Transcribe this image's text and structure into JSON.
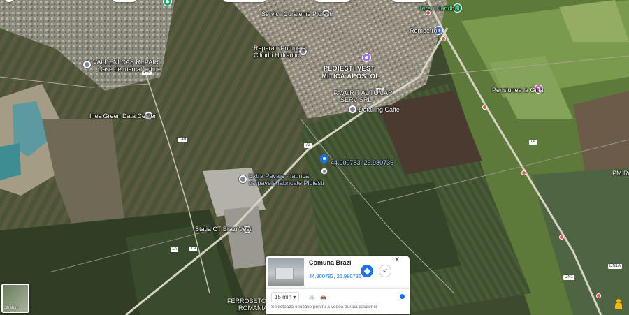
{
  "map": {
    "places": [
      {
        "id": "servicii",
        "label": "Servicii Curatenie Ploiesti"
      },
      {
        "id": "teren",
        "label": "Teren Handbal"
      },
      {
        "id": "rompetrol",
        "label": "Rompetrol"
      },
      {
        "id": "pompe1",
        "label": "Reparatii Pompe si"
      },
      {
        "id": "pompe2",
        "label": "Cilindri Hidraulici"
      },
      {
        "id": "valdeni1",
        "label": "VALDENI CAS REPAIR"
      },
      {
        "id": "valdeni2",
        "label": "Case de marcat ieftine"
      },
      {
        "id": "ploiesti_vest",
        "label": "PLOIESTI VEST"
      },
      {
        "id": "mitica",
        "label": "MITICA APOSTOL"
      },
      {
        "id": "favorit1",
        "label": "FAVORIT AUTOMAR"
      },
      {
        "id": "favorit2",
        "label": "SERV SRL"
      },
      {
        "id": "detailing",
        "label": "Detailing Caffe"
      },
      {
        "id": "pensiunea",
        "label": "Pensiunea la Gina"
      },
      {
        "id": "ines",
        "label": "Ines Green Data Center"
      },
      {
        "id": "coord_label",
        "label": "44.900783, 25.980736"
      },
      {
        "id": "fabrica1",
        "label": "Extra Pavaje - fabrica"
      },
      {
        "id": "fabrica2",
        "label": "de pavele fabricate Ploiesti"
      },
      {
        "id": "statia",
        "label": "Stația CT Brazi Vest"
      },
      {
        "id": "ferrobet1",
        "label": "FERROBETON"
      },
      {
        "id": "ferrobet2",
        "label": "ROMANIA"
      },
      {
        "id": "pm",
        "label": "PM Ran"
      }
    ],
    "road_badges": [
      "140",
      "140",
      "72",
      "72",
      "1A",
      "1A",
      "1A",
      "DN1",
      "DN1A"
    ]
  },
  "place_card": {
    "title": "Comuna Brazi",
    "coords": "44.900783, 25.980736",
    "close": "✕",
    "share": "<"
  },
  "travel": {
    "mins": "15 min ▾",
    "hint": "Selectează o locație pentru a vedea durata călătoriei",
    "bike": "🚲",
    "car": "🚗"
  },
  "layers": {
    "label": "Straturi"
  }
}
